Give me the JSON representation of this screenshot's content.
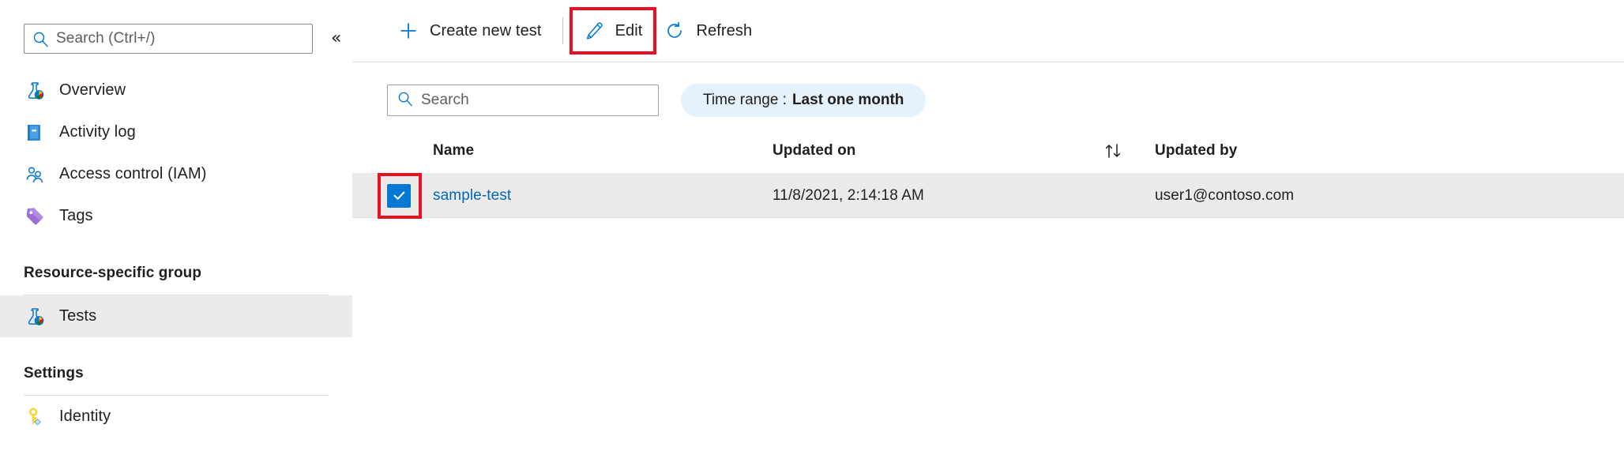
{
  "sidebar": {
    "search": {
      "placeholder": "Search (Ctrl+/)",
      "value": "",
      "icon": "search-icon"
    },
    "collapse_label": "«",
    "items": [
      {
        "label": "Overview",
        "icon": "flask-icon",
        "selected": false
      },
      {
        "label": "Activity log",
        "icon": "book-icon",
        "selected": false
      },
      {
        "label": "Access control (IAM)",
        "icon": "people-icon",
        "selected": false
      },
      {
        "label": "Tags",
        "icon": "tag-icon",
        "selected": false
      }
    ],
    "groups": [
      {
        "title": "Resource-specific group",
        "items": [
          {
            "label": "Tests",
            "icon": "flask-icon",
            "selected": true
          }
        ]
      },
      {
        "title": "Settings",
        "items": [
          {
            "label": "Identity",
            "icon": "key-icon",
            "selected": false
          }
        ]
      }
    ]
  },
  "toolbar": {
    "create_label": "Create new test",
    "create_icon": "plus-icon",
    "edit_label": "Edit",
    "edit_icon": "pencil-icon",
    "refresh_label": "Refresh",
    "refresh_icon": "refresh-icon"
  },
  "filters": {
    "search": {
      "placeholder": "Search",
      "value": "",
      "icon": "search-icon"
    },
    "time_range": {
      "label": "Time range :",
      "value": "Last one month"
    }
  },
  "table": {
    "columns": {
      "name": "Name",
      "updated_on": "Updated on",
      "updated_by": "Updated by"
    },
    "sort_icon": "sort-arrows-icon",
    "rows": [
      {
        "selected": true,
        "name": "sample-test",
        "updated_on": "11/8/2021, 2:14:18 AM",
        "updated_by": "user1@contoso.com"
      }
    ]
  },
  "annotations": {
    "color": "#e81123",
    "targets": [
      "edit-button",
      "row-checkbox"
    ]
  },
  "colors": {
    "accent": "#0078d4",
    "link": "#0067b8",
    "row_selected_bg": "#edebe9",
    "pill_bg": "#e5f1fb",
    "annotation": "#e81123"
  }
}
